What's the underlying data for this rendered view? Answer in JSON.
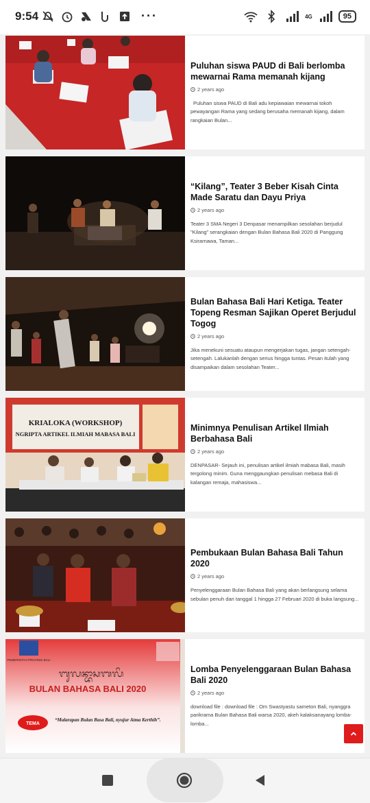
{
  "status": {
    "time": "9:54",
    "network": "4G",
    "battery": "95"
  },
  "articles": [
    {
      "title": "Puluhan siswa PAUD di Bali berlomba mewarnai Rama memanah kijang",
      "date": "2 years ago",
      "excerpt": "Puluhan siswa PAUD di Bali adu kepiawaian mewarnai tokoh pewayangan Rama yang sedang berusaha memanah kijang, dalam rangkaian Bulan..."
    },
    {
      "title": "“Kilang”, Teater 3 Beber Kisah Cinta Made Saratu dan Dayu Priya",
      "date": "2 years ago",
      "excerpt": "Teater 3 SMA Negeri 3 Denpasar menampilkan sesolahan berjudul \"Kilang\" serangkaian dengan Bulan Bahasa Bali 2020 di Panggung Ksirarnawa, Taman..."
    },
    {
      "title": "Bulan Bahasa Bali Hari Ketiga. Teater Topeng Resman Sajikan Operet Berjudul Togog",
      "date": "2 years ago",
      "excerpt": "Jika menekuni sesuatu ataupun mengerjakan tugas, jangan setengah-setengah. Lalukanlah dengan serius hingga tuntas. Pesan itulah yang disampaikan dalam sesolahan Teater..."
    },
    {
      "title": "Minimnya Penulisan Artikel Ilmiah Berbahasa Bali",
      "date": "2 years ago",
      "excerpt": "DENPASAR- Sejauh ini, penulisan artikel ilmiah mabasa Bali, masih tergolong minim. Guna menggaungkan penulisan mebasa Bali di kalangan remaja, mahasiswa..."
    },
    {
      "title": "Pembukaan Bulan Bahasa Bali Tahun 2020",
      "date": "2 years ago",
      "excerpt": "Penyelenggaraan Bulan Bahasa Bali yang akan berlangsung selama sebulan penuh dari tanggal 1 hingga 27 Februari 2020 di buka langsung..."
    },
    {
      "title": "Lomba Penyelenggaraan Bulan Bahasa Bali 2020",
      "date": "2 years ago",
      "excerpt": "download file : download file : Om Swastyastu sameton Bali, nyanggra parikrama Bulan Bahasa Bali warsa 2020, akeh kalaksanayang lomba-lomba..."
    }
  ],
  "images": {
    "banner4_line1": "KRIALOKA (WORKSHOP)",
    "banner4_line2": "NGRIPTA ARTIKEL ILMIAH MABASA BALI",
    "poster_org": "PEMERINTAH PROVINSI BALI",
    "poster_script": "ᬩᬸᬮᬦ᭄ᬪᬵᬲᬩᬮᬶ",
    "poster_title": "BULAN BAHASA BALI 2020",
    "poster_tema": "TEMA",
    "poster_quote": "“Malarapan Bulan Basa Bali, nyujur Atma Kerthih”."
  },
  "colors": {
    "accent_red": "#e01b1b",
    "card_bg": "#ffffff",
    "page_bg": "#f1f1f1"
  },
  "icons": {
    "scroll_top": "chevron-up-icon",
    "date": "clock-icon"
  }
}
